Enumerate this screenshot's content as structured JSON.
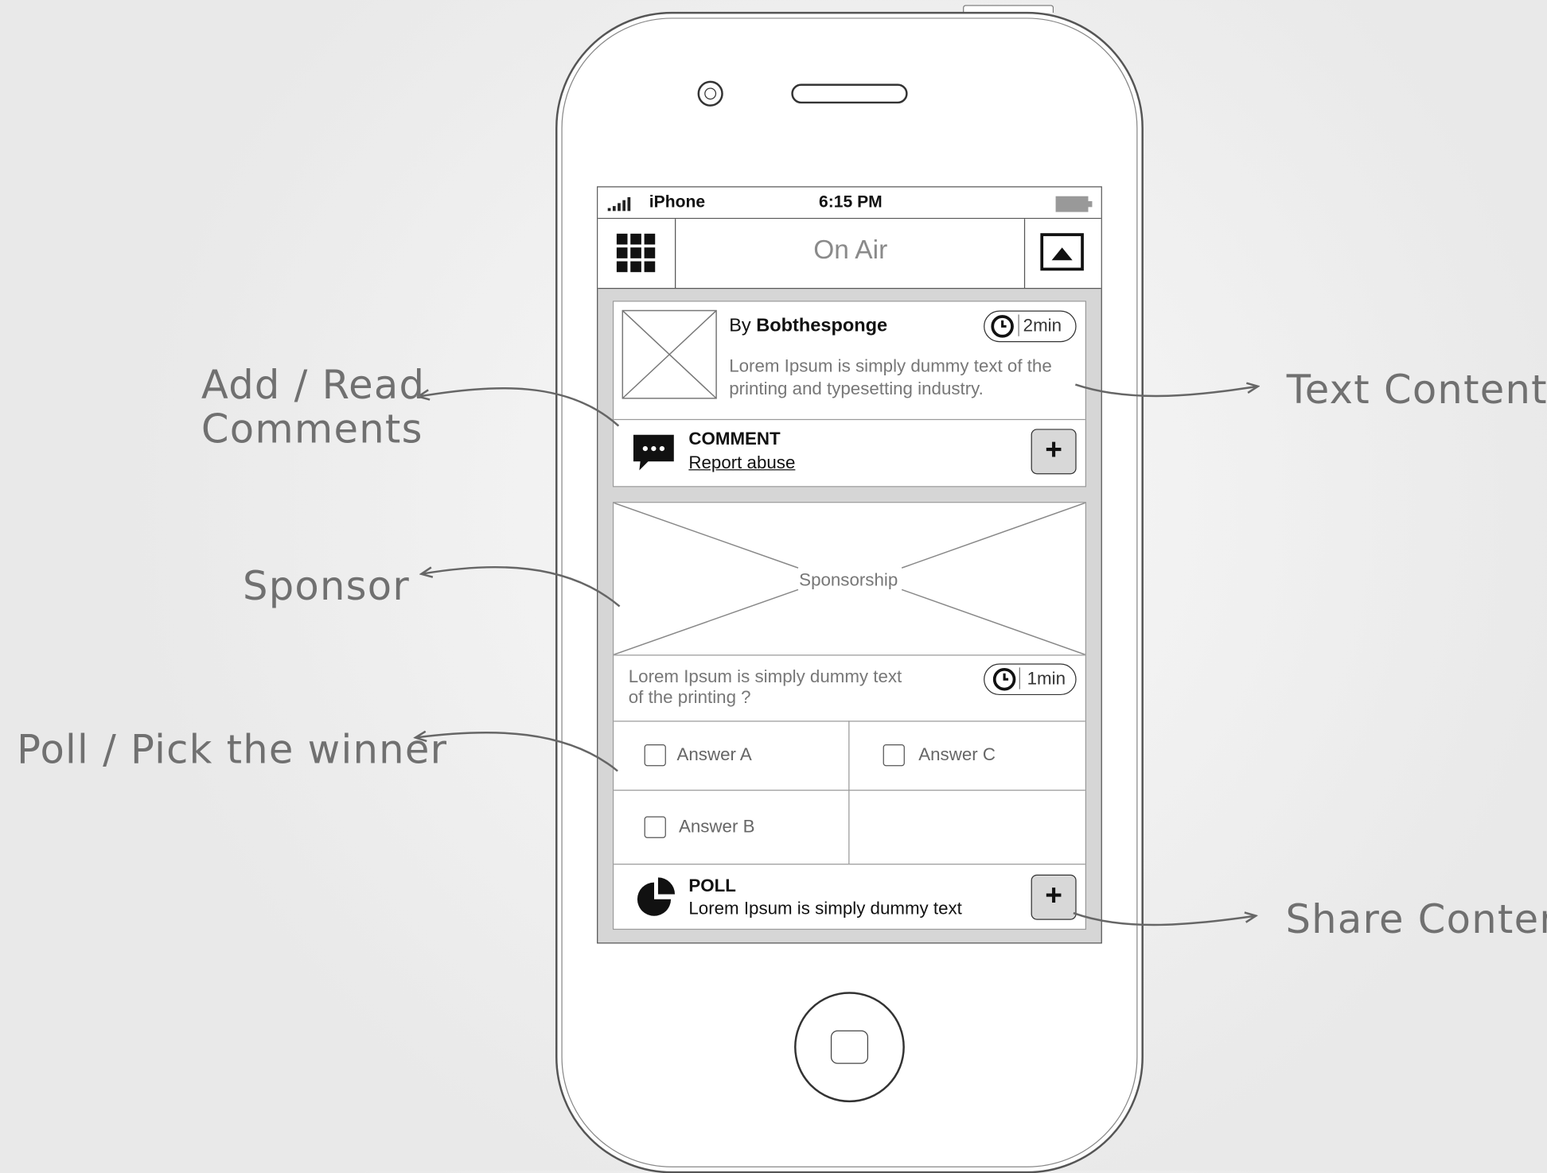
{
  "status_bar": {
    "carrier": "iPhone",
    "time": "6:15 PM"
  },
  "nav": {
    "title": "On Air"
  },
  "post": {
    "by_prefix": "By",
    "author": "Bobthesponge",
    "duration": "2min",
    "text_line1": "Lorem Ipsum is simply dummy text of the",
    "text_line2": "printing and typesetting industry.",
    "comment_label": "COMMENT",
    "report_label": "Report abuse",
    "add_label": "+"
  },
  "sponsor": {
    "label": "Sponsorship"
  },
  "poll": {
    "question_line1": "Lorem Ipsum is simply dummy text",
    "question_line2": "of the printing ?",
    "duration": "1min",
    "answers": [
      "Answer A",
      "Answer C",
      "Answer B"
    ],
    "footer_title": "POLL",
    "footer_text": "Lorem Ipsum is simply dummy text",
    "add_label": "+"
  },
  "annotations": {
    "comments_line1": "Add / Read",
    "comments_line2": "Comments",
    "sponsor": "Sponsor",
    "poll": "Poll / Pick the winner",
    "text_content": "Text Content",
    "share_content": "Share Content"
  },
  "colors": {
    "screen_bg": "#d6d6d6",
    "annotation_text": "#707070",
    "arrow": "#666666",
    "button_fill": "#d8d8d8"
  }
}
